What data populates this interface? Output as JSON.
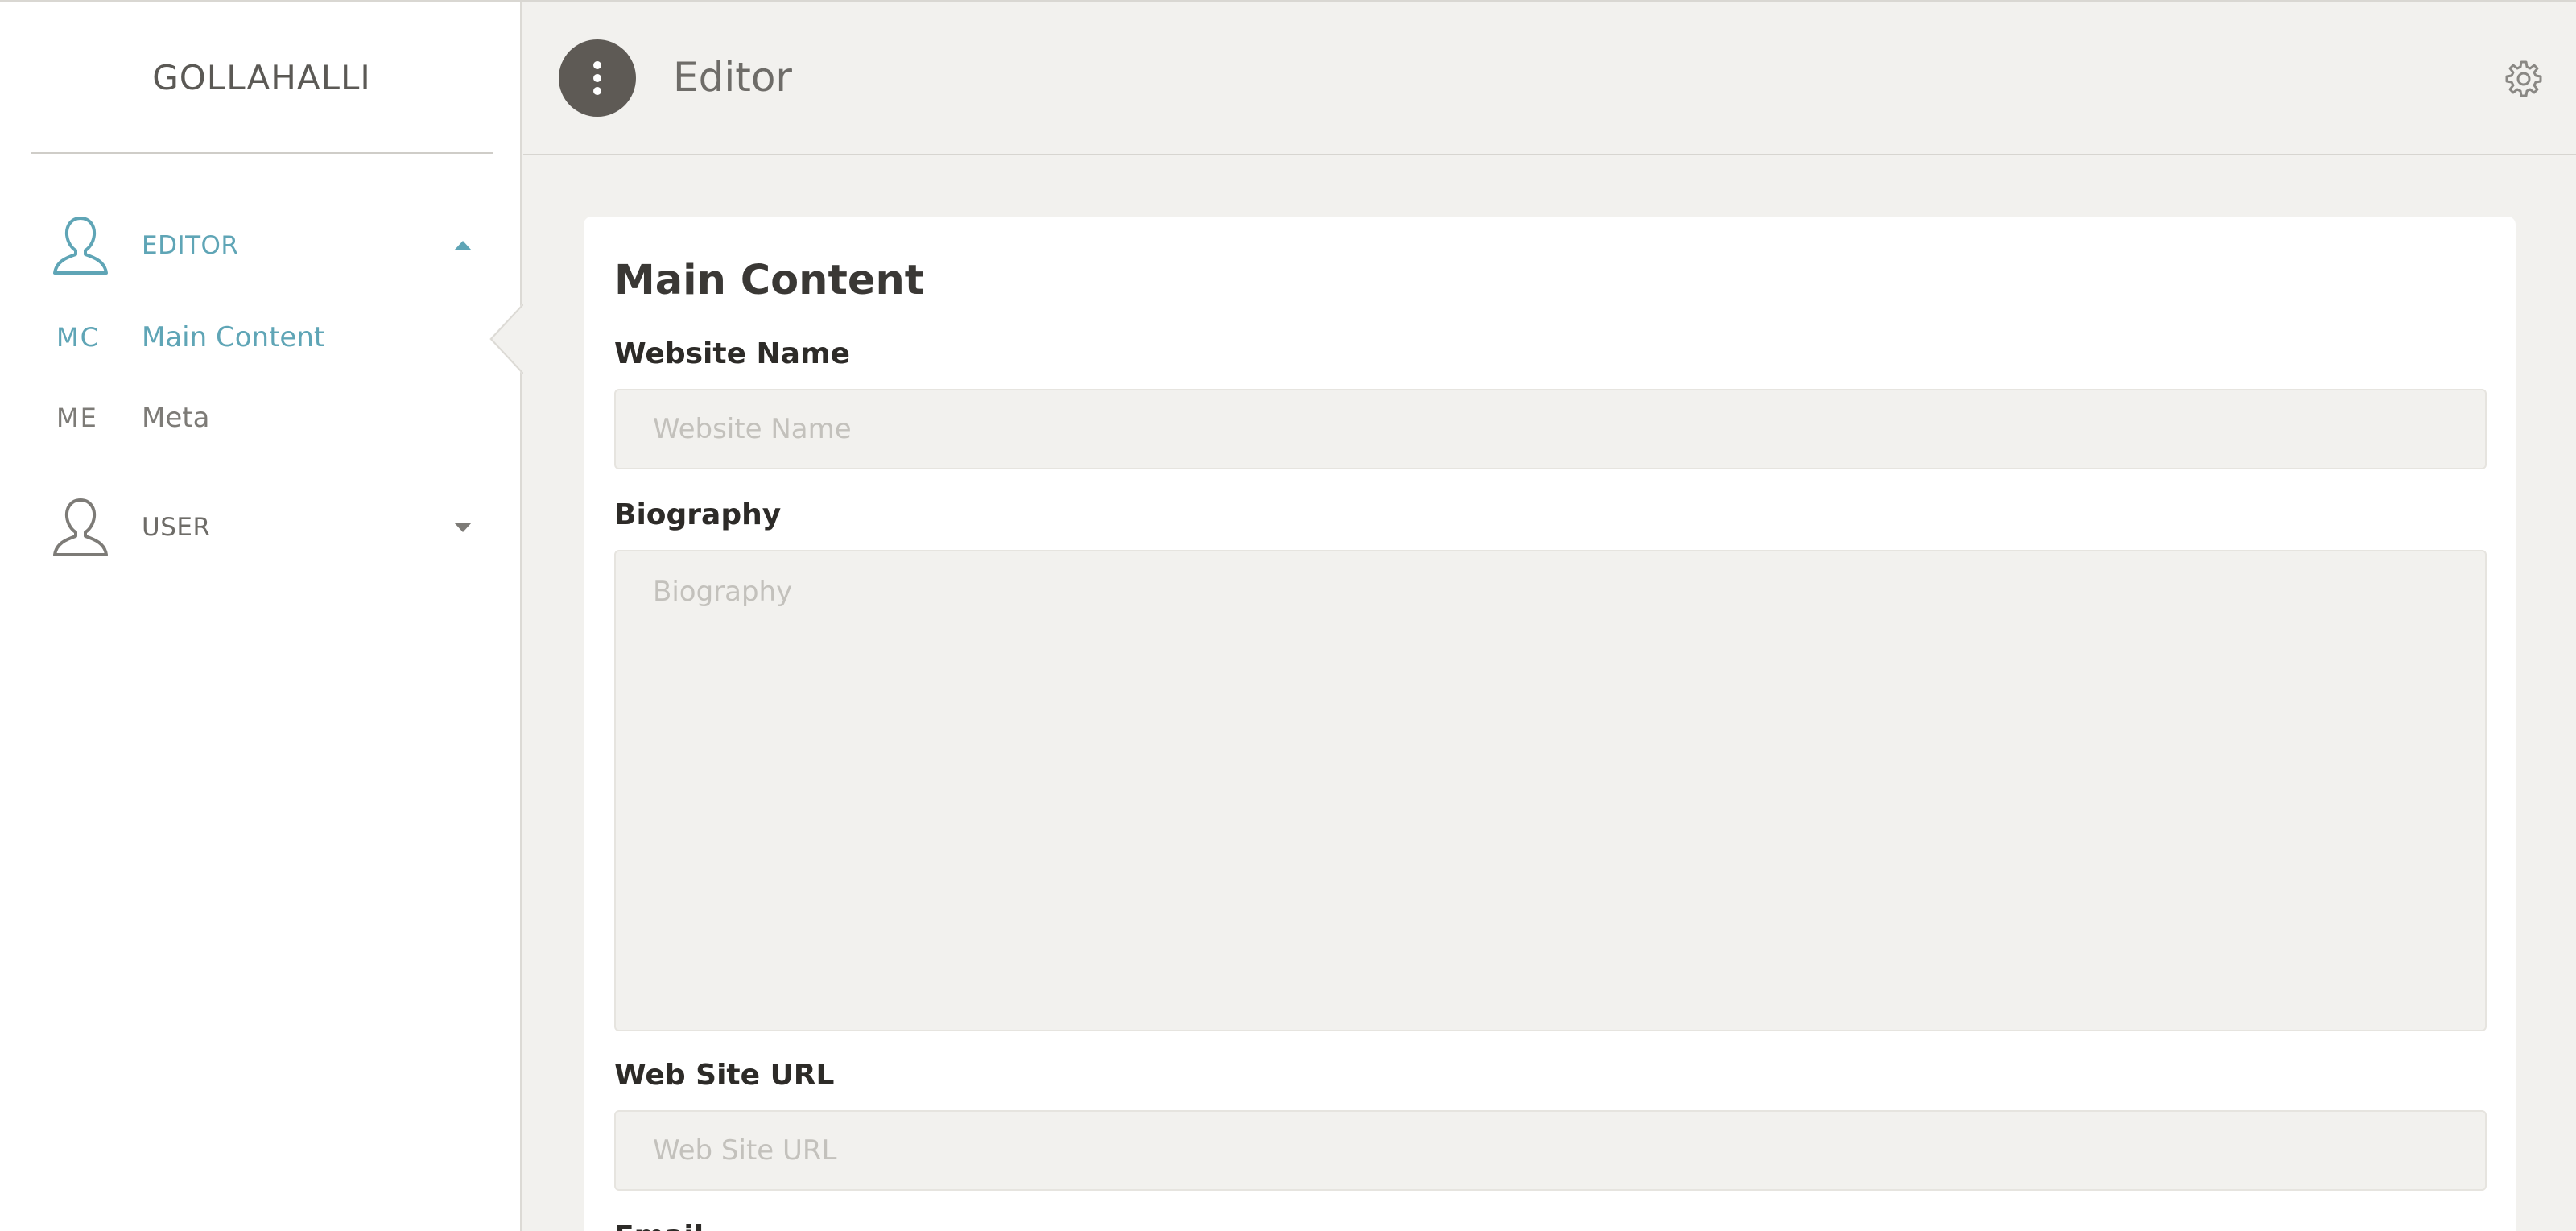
{
  "sidebar": {
    "brand": "GOLLAHALLI",
    "groups": [
      {
        "label": "EDITOR",
        "expanded": true,
        "items": [
          {
            "abbr": "MC",
            "label": "Main Content",
            "active": true
          },
          {
            "abbr": "ME",
            "label": "Meta",
            "active": false
          }
        ]
      },
      {
        "label": "USER",
        "expanded": false,
        "items": []
      }
    ]
  },
  "topbar": {
    "title": "Editor",
    "menu_icon": "vertical-dots-icon",
    "settings_icon": "gear-icon"
  },
  "card": {
    "title": "Main Content",
    "fields": [
      {
        "label": "Website Name",
        "placeholder": "Website Name",
        "value": ""
      },
      {
        "label": "Biography",
        "placeholder": "Biography",
        "value": ""
      },
      {
        "label": "Web Site URL",
        "placeholder": "Web Site URL",
        "value": ""
      },
      {
        "label": "Email"
      }
    ]
  },
  "colors": {
    "accent": "#5fa5b6",
    "background": "#f2f1ee",
    "menu_button": "#5e5a55",
    "muted_text": "#6e6c68"
  }
}
